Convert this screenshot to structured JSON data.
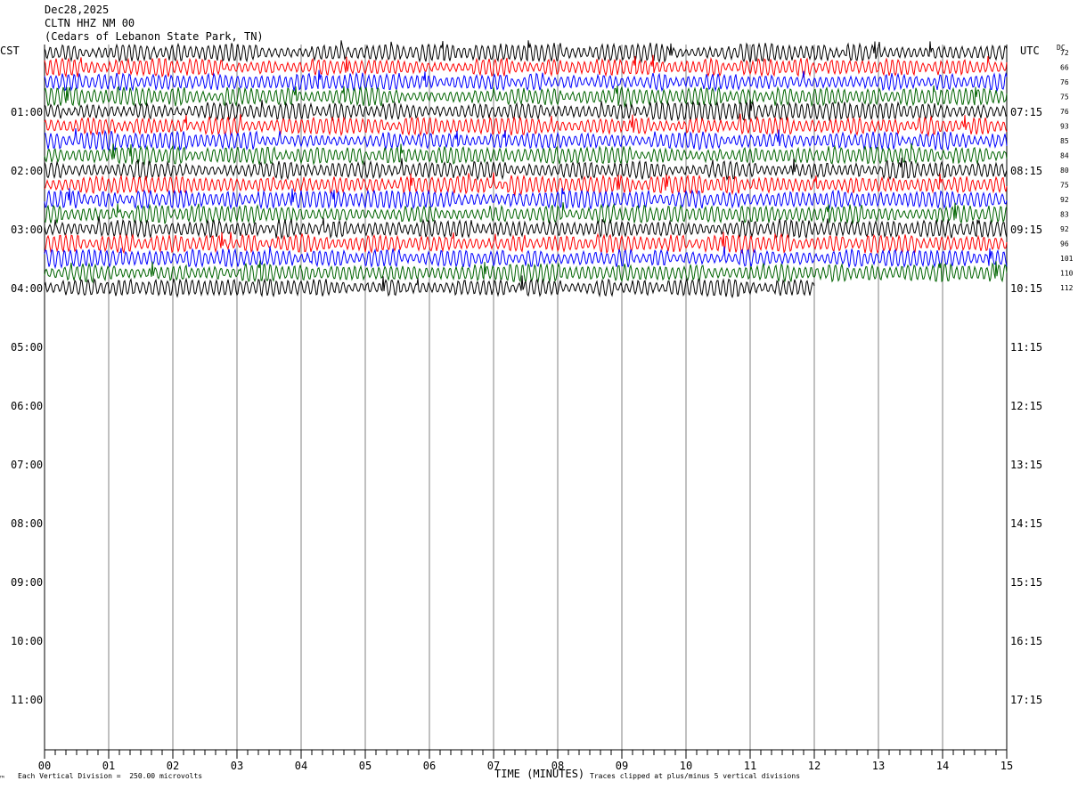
{
  "header": {
    "date": "Dec28,2025",
    "station": "CLTN HHZ NM 00",
    "location": "(Cedars of Lebanon State Park, TN)"
  },
  "left_tz": "CST",
  "right_tz": "UTC",
  "dc_label": "DC",
  "footer": {
    "scale_note": "Each Vertical Division =  250.00 microvolts",
    "xlabel": "TIME (MINUTES)",
    "clip_note": "Traces clipped at plus/minus 5 vertical divisions",
    "corner_mark": "™"
  },
  "colors": {
    "trace_cycle": [
      "#000000",
      "#ff0000",
      "#0000ff",
      "#006400"
    ],
    "grid": "#808080",
    "axis": "#000000"
  },
  "chart_data": {
    "type": "line",
    "title": "CLTN HHZ NM 00",
    "xlabel": "TIME (MINUTES)",
    "x_range": [
      0,
      15
    ],
    "x_ticks": [
      "00",
      "01",
      "02",
      "03",
      "04",
      "05",
      "06",
      "07",
      "08",
      "09",
      "10",
      "11",
      "12",
      "13",
      "14",
      "15"
    ],
    "left_hour_labels": [
      "01:00",
      "02:00",
      "03:00",
      "04:00",
      "05:00",
      "06:00",
      "07:00",
      "08:00",
      "09:00",
      "10:00",
      "11:00"
    ],
    "right_hour_labels": [
      "07:15",
      "08:15",
      "09:15",
      "10:15",
      "11:15",
      "12:15",
      "13:15",
      "14:15",
      "15:15",
      "16:15",
      "17:15"
    ],
    "dc_offsets": [
      72,
      66,
      76,
      75,
      76,
      93,
      85,
      84,
      80,
      75,
      92,
      83,
      92,
      96,
      101,
      110,
      112
    ],
    "trace_count": 17,
    "last_trace_end_minute": 12.0,
    "grid": true
  }
}
